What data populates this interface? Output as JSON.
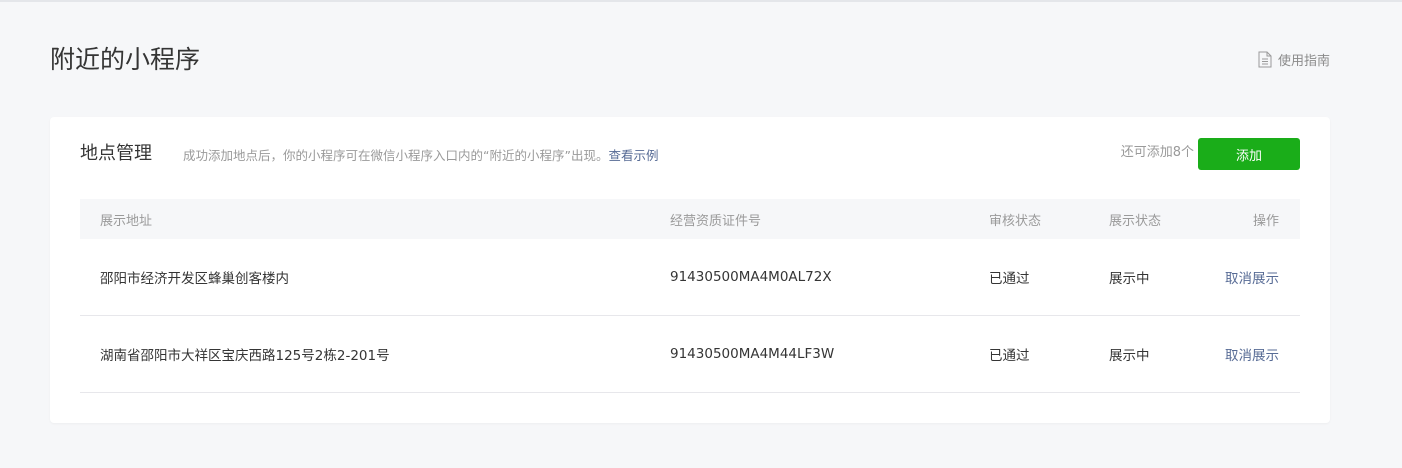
{
  "page": {
    "title": "附近的小程序",
    "guide_label": "使用指南"
  },
  "card": {
    "title": "地点管理",
    "description": "成功添加地点后，你的小程序可在微信小程序入口内的“附近的小程序”出现。",
    "example_link": "查看示例",
    "quota_text": "还可添加8个",
    "add_button": "添加"
  },
  "table": {
    "headers": {
      "address": "展示地址",
      "license": "经营资质证件号",
      "review": "审核状态",
      "display": "展示状态",
      "action": "操作"
    },
    "rows": [
      {
        "address": "邵阳市经济开发区蜂巢创客楼内",
        "license": "91430500MA4M0AL72X",
        "review": "已通过",
        "display": "展示中",
        "action": "取消展示"
      },
      {
        "address": "湖南省邵阳市大祥区宝庆西路125号2栋2-201号",
        "license": "91430500MA4M44LF3W",
        "review": "已通过",
        "display": "展示中",
        "action": "取消展示"
      }
    ]
  },
  "colors": {
    "accent_green": "#1aad19",
    "link_blue": "#576b95",
    "background": "#f6f7f9"
  },
  "icons": {
    "guide": "document-icon"
  }
}
